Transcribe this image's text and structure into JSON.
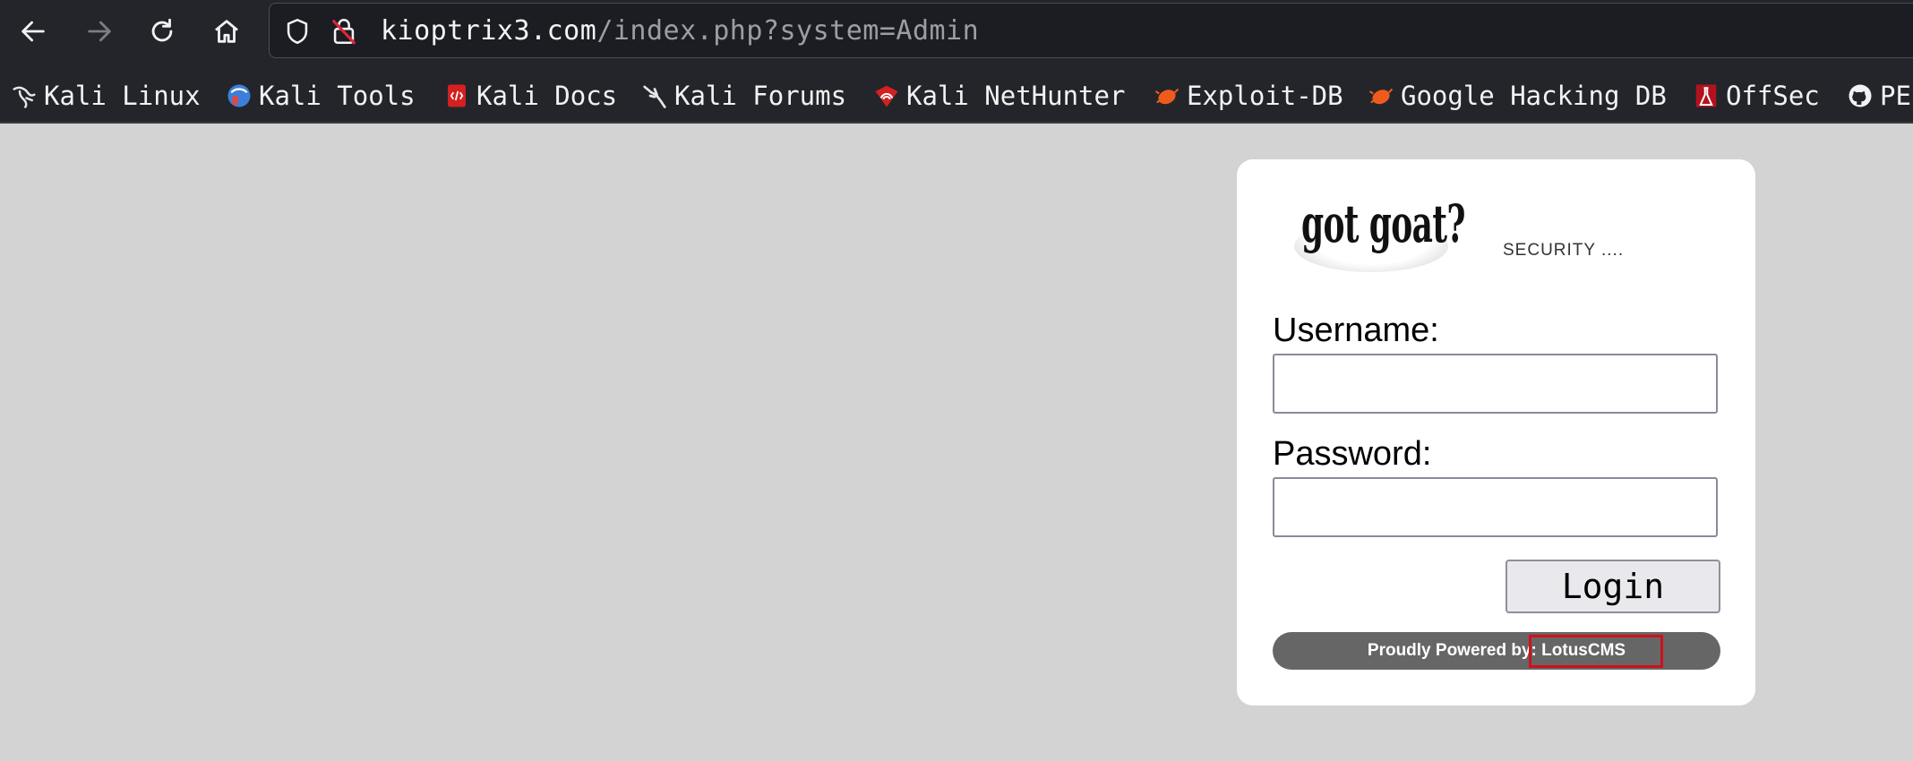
{
  "browser": {
    "url": {
      "host": "kioptrix3.com",
      "path": "/index.php?system=Admin"
    },
    "icons": [
      "back-icon",
      "forward-icon",
      "reload-icon",
      "home-icon",
      "shield-icon",
      "insecure-lock-icon"
    ],
    "bookmarks": [
      {
        "label": "Kali Linux",
        "icon": "kali-dragon-icon"
      },
      {
        "label": "Kali Tools",
        "icon": "kali-tools-icon"
      },
      {
        "label": "Kali Docs",
        "icon": "kali-docs-icon"
      },
      {
        "label": "Kali Forums",
        "icon": "kali-forums-icon"
      },
      {
        "label": "Kali NetHunter",
        "icon": "nethunter-icon"
      },
      {
        "label": "Exploit-DB",
        "icon": "exploit-db-icon"
      },
      {
        "label": "Google Hacking DB",
        "icon": "ghdb-icon"
      },
      {
        "label": "OffSec",
        "icon": "offsec-icon"
      },
      {
        "label": "PE",
        "icon": "github-icon"
      }
    ]
  },
  "login": {
    "logo_text": "got goat?",
    "tagline": "SECURITY ....",
    "username_label": "Username:",
    "username_value": "",
    "password_label": "Password:",
    "password_value": "",
    "login_button": "Login",
    "footer_prefix": "Proudly Powered by",
    "footer_cms": ": LotusCMS"
  },
  "colors": {
    "page_background": "#d3d3d3",
    "chrome_background": "#23252b",
    "footer_background": "#666666",
    "highlight_border": "#d0101a"
  }
}
